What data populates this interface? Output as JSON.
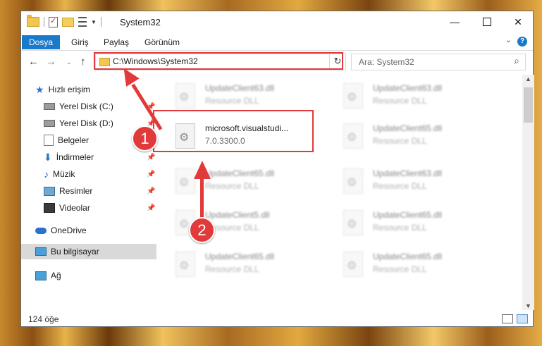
{
  "window": {
    "title": "System32",
    "minimize_icon": "minimize-icon",
    "maximize_icon": "maximize-icon",
    "close_icon": "close-icon"
  },
  "ribbon": {
    "tabs": [
      {
        "label": "Dosya",
        "active": true
      },
      {
        "label": "Giriş",
        "active": false
      },
      {
        "label": "Paylaş",
        "active": false
      },
      {
        "label": "Görünüm",
        "active": false
      }
    ],
    "accent": "#1979ca"
  },
  "navigation": {
    "address_path": "C:\\Windows\\System32",
    "search_placeholder": "Ara: System32"
  },
  "sidebar": {
    "items": [
      {
        "label": "Hızlı erişim",
        "icon": "star-icon"
      },
      {
        "label": "Yerel Disk (C:)",
        "icon": "disk-icon",
        "pinned": true
      },
      {
        "label": "Yerel Disk (D:)",
        "icon": "disk-icon",
        "pinned": true
      },
      {
        "label": "Belgeler",
        "icon": "documents-icon",
        "pinned": true
      },
      {
        "label": "İndirmeler",
        "icon": "download-icon",
        "pinned": true
      },
      {
        "label": "Müzik",
        "icon": "music-icon",
        "pinned": true
      },
      {
        "label": "Resimler",
        "icon": "pictures-icon",
        "pinned": true
      },
      {
        "label": "Videolar",
        "icon": "videos-icon",
        "pinned": true
      },
      {
        "label": "OneDrive",
        "icon": "onedrive-icon"
      },
      {
        "label": "Bu bilgisayar",
        "icon": "computer-icon",
        "selected": true
      },
      {
        "label": "Ağ",
        "icon": "network-icon"
      }
    ]
  },
  "files": [
    {
      "name": "UpdateClient63.dll",
      "desc": "Resource DLL"
    },
    {
      "name": "UpdateClient63.dll",
      "desc": "Resource DLL"
    },
    {
      "name": "microsoft.visualstudi...",
      "desc": "7.0.3300.0"
    },
    {
      "name": "UpdateClient65.dll",
      "desc": "Resource DLL"
    },
    {
      "name": "UpdateClient65.dll",
      "desc": "Resource DLL"
    },
    {
      "name": "UpdateClient63.dll",
      "desc": "Resource DLL"
    },
    {
      "name": "UpdateClient5.dll",
      "desc": "Resource DLL"
    },
    {
      "name": "UpdateClient65.dll",
      "desc": "Resource DLL"
    },
    {
      "name": "UpdateClient65.dll",
      "desc": "Resource DLL"
    },
    {
      "name": "UpdateClient65.dll",
      "desc": "Resource DLL"
    }
  ],
  "status": {
    "item_count": "124 öğe"
  },
  "annotations": {
    "step1": "1",
    "step2": "2",
    "color": "#e23a3a"
  }
}
